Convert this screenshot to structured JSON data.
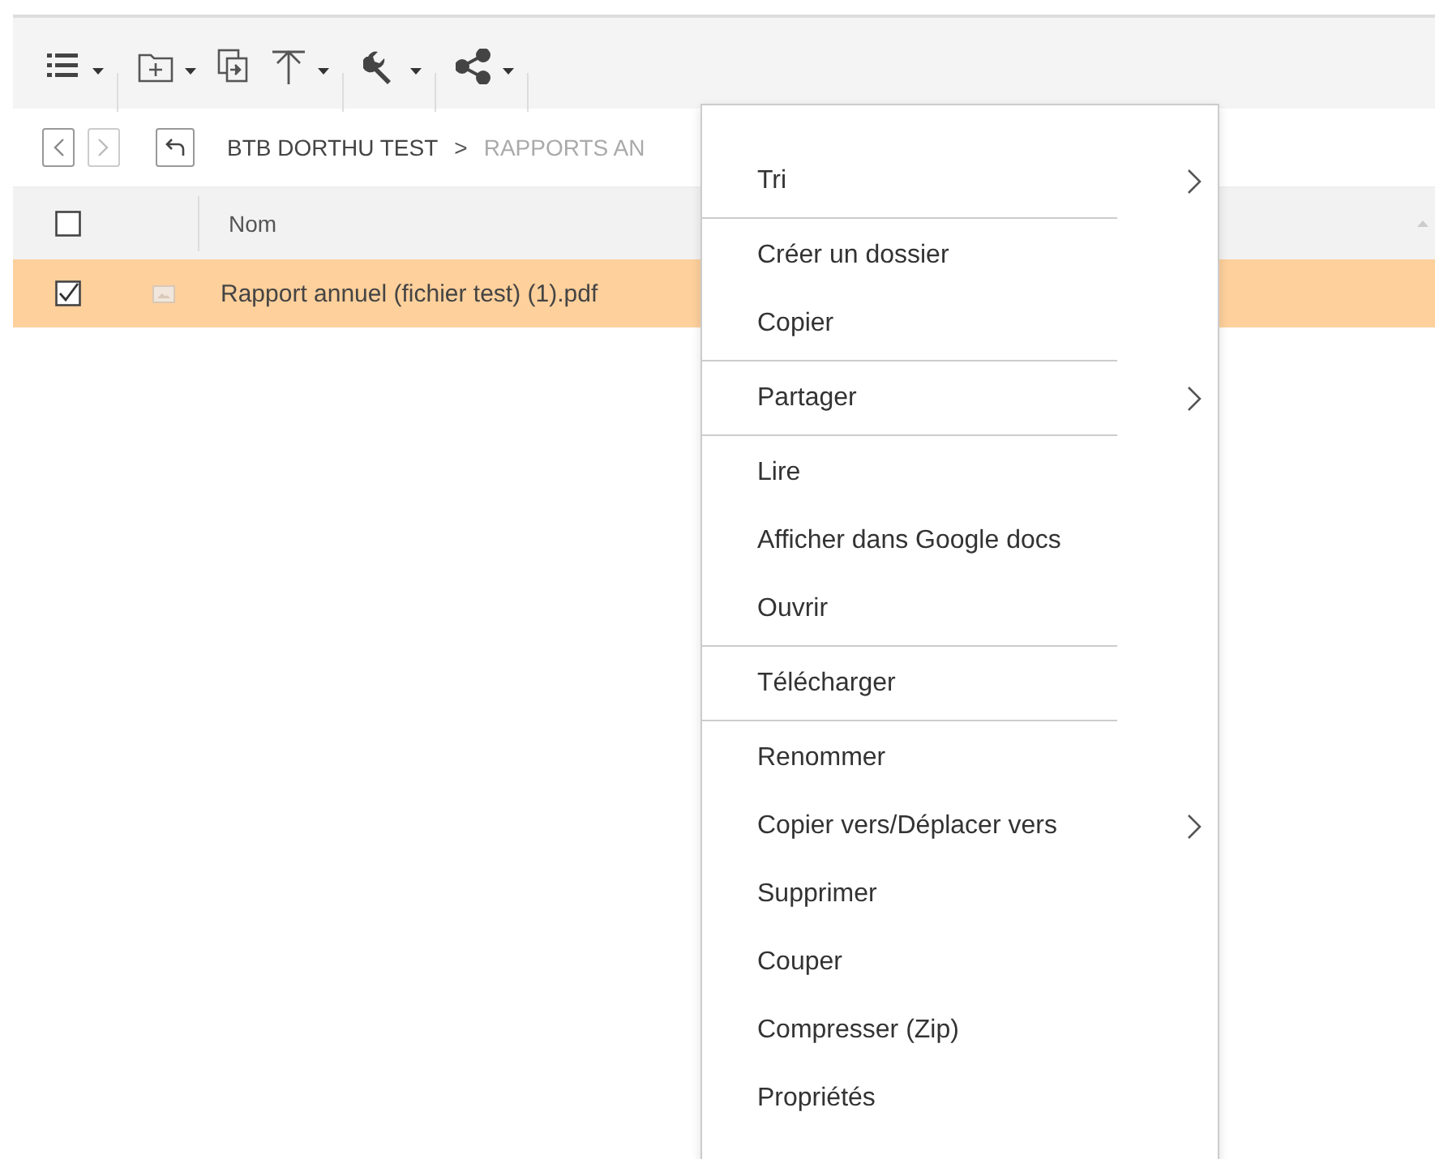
{
  "toolbar": [
    {
      "kind": "list",
      "dropdown": true,
      "divider_after": true
    },
    {
      "kind": "new-folder",
      "dropdown": true,
      "divider_after": false
    },
    {
      "kind": "copy",
      "dropdown": false,
      "divider_after": false
    },
    {
      "kind": "upload",
      "dropdown": true,
      "divider_after": true
    },
    {
      "kind": "wrench",
      "dropdown": true,
      "divider_after": true
    },
    {
      "kind": "share",
      "dropdown": true,
      "divider_after": true
    }
  ],
  "breadcrumb": {
    "back_disabled": false,
    "forward_disabled": true,
    "crumbs": [
      {
        "label": "BTB DORTHU TEST",
        "current": false
      },
      {
        "label": "RAPPORTS AN",
        "current": true
      }
    ],
    "separator": ">"
  },
  "table": {
    "columns": [
      {
        "label": "Nom"
      }
    ],
    "header_checked": false,
    "rows": [
      {
        "name": "Rapport annuel (fichier test) (1).pdf",
        "checked": true,
        "selected": true
      }
    ]
  },
  "context_menu": {
    "groups": [
      [
        {
          "label": "Tri",
          "submenu": true
        }
      ],
      [
        {
          "label": "Créer un dossier",
          "submenu": false
        },
        {
          "label": "Copier",
          "submenu": false
        }
      ],
      [
        {
          "label": "Partager",
          "submenu": true
        }
      ],
      [
        {
          "label": "Lire",
          "submenu": false
        },
        {
          "label": "Afficher dans Google docs",
          "submenu": false
        },
        {
          "label": "Ouvrir",
          "submenu": false
        }
      ],
      [
        {
          "label": "Télécharger",
          "submenu": false
        }
      ],
      [
        {
          "label": "Renommer",
          "submenu": false
        },
        {
          "label": "Copier vers/Déplacer vers",
          "submenu": true
        },
        {
          "label": "Supprimer",
          "submenu": false
        },
        {
          "label": "Couper",
          "submenu": false
        },
        {
          "label": "Compresser (Zip)",
          "submenu": false
        },
        {
          "label": "Propriétés",
          "submenu": false
        }
      ]
    ]
  }
}
